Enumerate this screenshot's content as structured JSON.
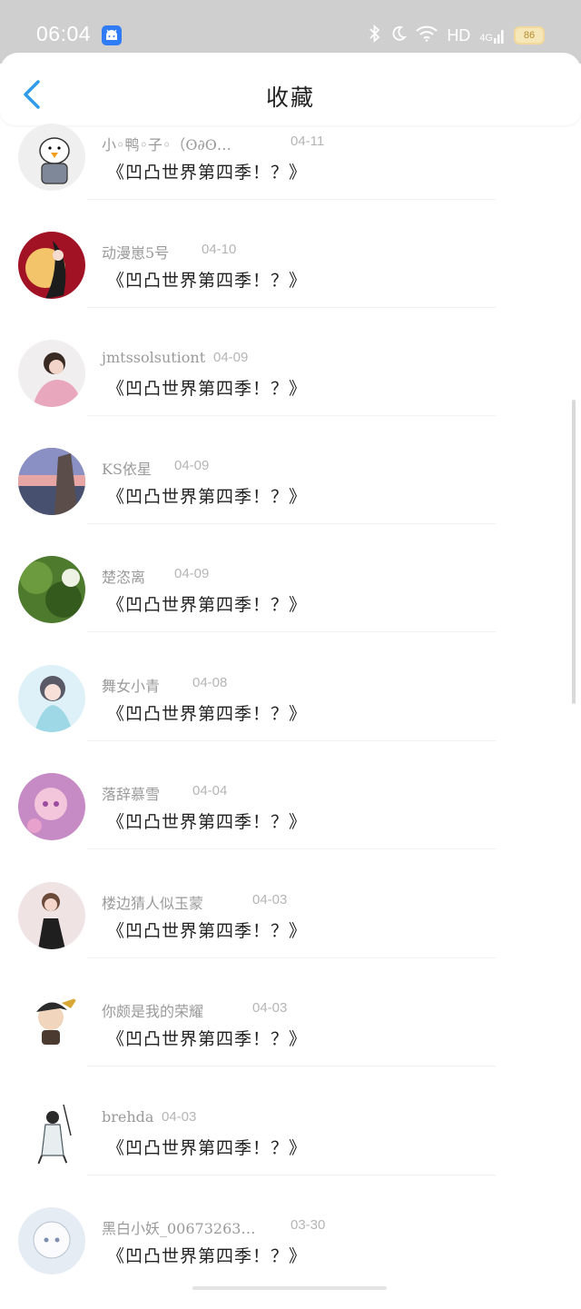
{
  "status": {
    "time": "06:04",
    "hd": "HD",
    "network": "4G",
    "battery": "86"
  },
  "header": {
    "title": "收藏"
  },
  "items": [
    {
      "name": "小◦鸭◦子◦（ʘ∂ʘ…",
      "date": "04-11",
      "title": "《凹凸世界第四季！？》",
      "avatar_color": "#e8e8e8",
      "avatar_icon": "duck-avatar"
    },
    {
      "name": "动漫崽5号",
      "date": "04-10",
      "title": "《凹凸世界第四季！？》",
      "avatar_color": "#a11225",
      "avatar_icon": "moon-girl-avatar"
    },
    {
      "name": "jmtssolsutiont",
      "date": "04-09",
      "title": "《凹凸世界第四季！？》",
      "avatar_color": "#e9b9c6",
      "avatar_icon": "girl-photo-avatar"
    },
    {
      "name": "KS依星",
      "date": "04-09",
      "title": "《凹凸世界第四季！？》",
      "avatar_color": "#6f7fa6",
      "avatar_icon": "sunset-avatar"
    },
    {
      "name": "楚恣离",
      "date": "04-09",
      "title": "《凹凸世界第四季！？》",
      "avatar_color": "#4e7a2e",
      "avatar_icon": "green-plant-avatar"
    },
    {
      "name": "舞女小青",
      "date": "04-08",
      "title": "《凹凸世界第四季！？》",
      "avatar_color": "#bde3f2",
      "avatar_icon": "anime-girl-avatar"
    },
    {
      "name": "落辞慕雪",
      "date": "04-04",
      "title": "《凹凸世界第四季！？》",
      "avatar_color": "#c68ac4",
      "avatar_icon": "pink-anime-avatar"
    },
    {
      "name": "楼边猜人似玉蒙",
      "date": "04-03",
      "title": "《凹凸世界第四季！？》",
      "avatar_color": "#efe3e3",
      "avatar_icon": "child-photo-avatar"
    },
    {
      "name": "你颇是我的荣耀",
      "date": "04-03",
      "title": "《凹凸世界第四季！？》",
      "avatar_color": "#f5f0e6",
      "avatar_icon": "chibi-warrior-avatar"
    },
    {
      "name": "brehda",
      "date": "04-03",
      "title": "《凹凸世界第四季！？》",
      "avatar_color": "#ffffff",
      "avatar_icon": "sketch-figure-avatar"
    },
    {
      "name": "黑白小妖_00673263…",
      "date": "03-30",
      "title": "《凹凸世界第四季！？》",
      "avatar_color": "#dfe6ef",
      "avatar_icon": "white-anime-avatar"
    }
  ]
}
